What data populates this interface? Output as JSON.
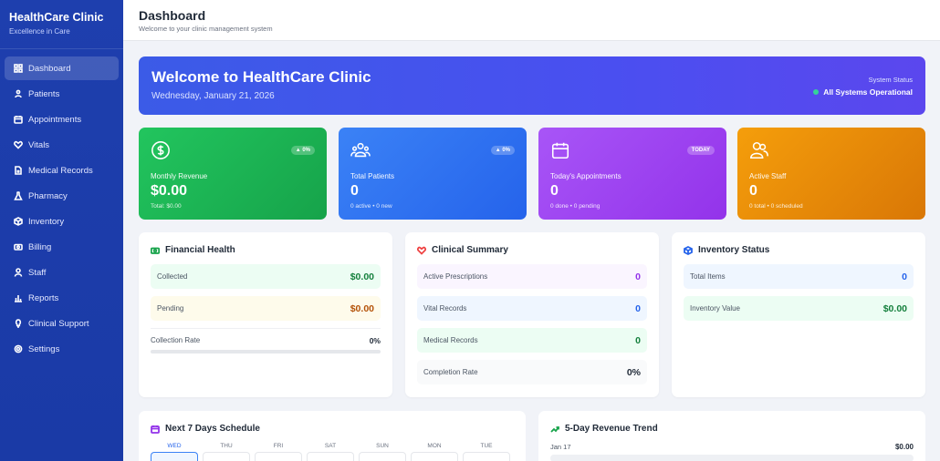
{
  "brand": {
    "title": "HealthCare Clinic",
    "subtitle": "Excellence in Care"
  },
  "nav": [
    {
      "label": "Dashboard",
      "icon": "grid-icon",
      "active": true
    },
    {
      "label": "Patients",
      "icon": "users-icon"
    },
    {
      "label": "Appointments",
      "icon": "calendar-icon"
    },
    {
      "label": "Vitals",
      "icon": "heart-icon"
    },
    {
      "label": "Medical Records",
      "icon": "file-icon"
    },
    {
      "label": "Pharmacy",
      "icon": "flask-icon"
    },
    {
      "label": "Inventory",
      "icon": "box-icon"
    },
    {
      "label": "Billing",
      "icon": "billing-icon"
    },
    {
      "label": "Staff",
      "icon": "staff-icon"
    },
    {
      "label": "Reports",
      "icon": "chart-icon"
    },
    {
      "label": "Clinical Support",
      "icon": "bulb-icon"
    },
    {
      "label": "Settings",
      "icon": "gear-icon"
    }
  ],
  "header": {
    "title": "Dashboard",
    "subtitle": "Welcome to your clinic management system"
  },
  "welcome": {
    "title": "Welcome to HealthCare Clinic",
    "date": "Wednesday, January 21, 2026",
    "status_label": "System Status",
    "status_value": "All Systems Operational"
  },
  "stats": [
    {
      "label": "Monthly Revenue",
      "value": "$0.00",
      "foot": "Total: $0.00",
      "badge": "▲ 0%",
      "icon": "dollar-icon"
    },
    {
      "label": "Total Patients",
      "value": "0",
      "foot": "0 active • 0 new",
      "badge": "▲ 0%",
      "icon": "users-icon"
    },
    {
      "label": "Today's Appointments",
      "value": "0",
      "foot": "0 done • 0 pending",
      "badge": "TODAY",
      "icon": "calendar-icon"
    },
    {
      "label": "Active Staff",
      "value": "0",
      "foot": "0 total • 0 scheduled",
      "badge": "",
      "icon": "staff-icon"
    }
  ],
  "financial": {
    "title": "Financial Health",
    "collected_label": "Collected",
    "collected_value": "$0.00",
    "pending_label": "Pending",
    "pending_value": "$0.00",
    "rate_label": "Collection Rate",
    "rate_value": "0%",
    "rate_fraction": 0
  },
  "clinical": {
    "title": "Clinical Summary",
    "rows": [
      {
        "label": "Active Prescriptions",
        "value": "0"
      },
      {
        "label": "Vital Records",
        "value": "0"
      },
      {
        "label": "Medical Records",
        "value": "0"
      },
      {
        "label": "Completion Rate",
        "value": "0%"
      }
    ]
  },
  "inventory": {
    "title": "Inventory Status",
    "rows": [
      {
        "label": "Total Items",
        "value": "0"
      },
      {
        "label": "Inventory Value",
        "value": "$0.00"
      }
    ]
  },
  "schedule": {
    "title": "Next 7 Days Schedule",
    "days": [
      "WED",
      "THU",
      "FRI",
      "SAT",
      "SUN",
      "MON",
      "TUE"
    ]
  },
  "trend": {
    "title": "5-Day Revenue Trend",
    "rows": [
      {
        "label": "Jan 17",
        "value": "$0.00"
      }
    ]
  },
  "colors": {
    "accent": "#1e3fae",
    "green": "#16a34a",
    "blue": "#2563eb",
    "purple": "#9333ea",
    "amber": "#d97706"
  }
}
